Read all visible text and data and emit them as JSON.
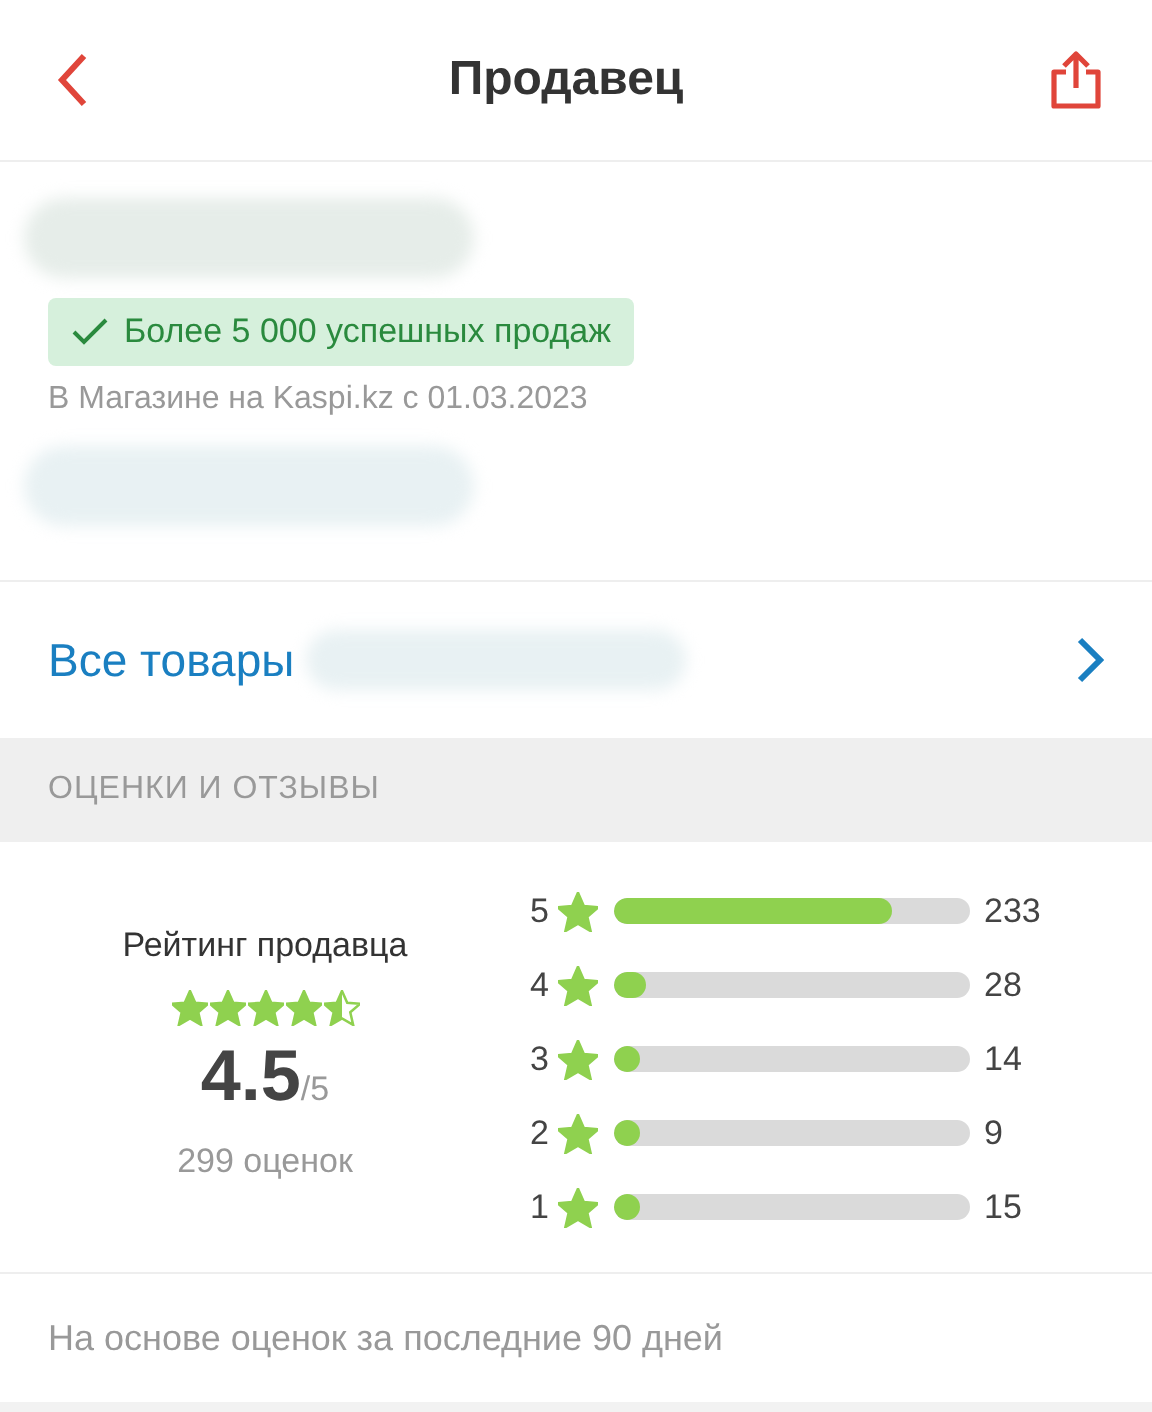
{
  "header": {
    "title": "Продавец"
  },
  "seller": {
    "badge": "Более 5 000 успешных продаж",
    "since": "В Магазине на Kaspi.kz с 01.03.2023"
  },
  "all_products": {
    "label": "Все товары"
  },
  "section_title": "ОЦЕНКИ И ОТЗЫВЫ",
  "rating": {
    "label": "Рейтинг продавца",
    "stars": 4.5,
    "value": "4.5",
    "max": "/5",
    "count": "299 оценок"
  },
  "distribution": [
    {
      "grade": "5",
      "level": 0.78,
      "count": "233"
    },
    {
      "grade": "4",
      "level": 0.09,
      "count": "28"
    },
    {
      "grade": "3",
      "level": 0.05,
      "count": "14"
    },
    {
      "grade": "2",
      "level": 0.03,
      "count": "9"
    },
    {
      "grade": "1",
      "level": 0.05,
      "count": "15"
    }
  ],
  "footnote": "На основе оценок за последние 90 дней"
}
